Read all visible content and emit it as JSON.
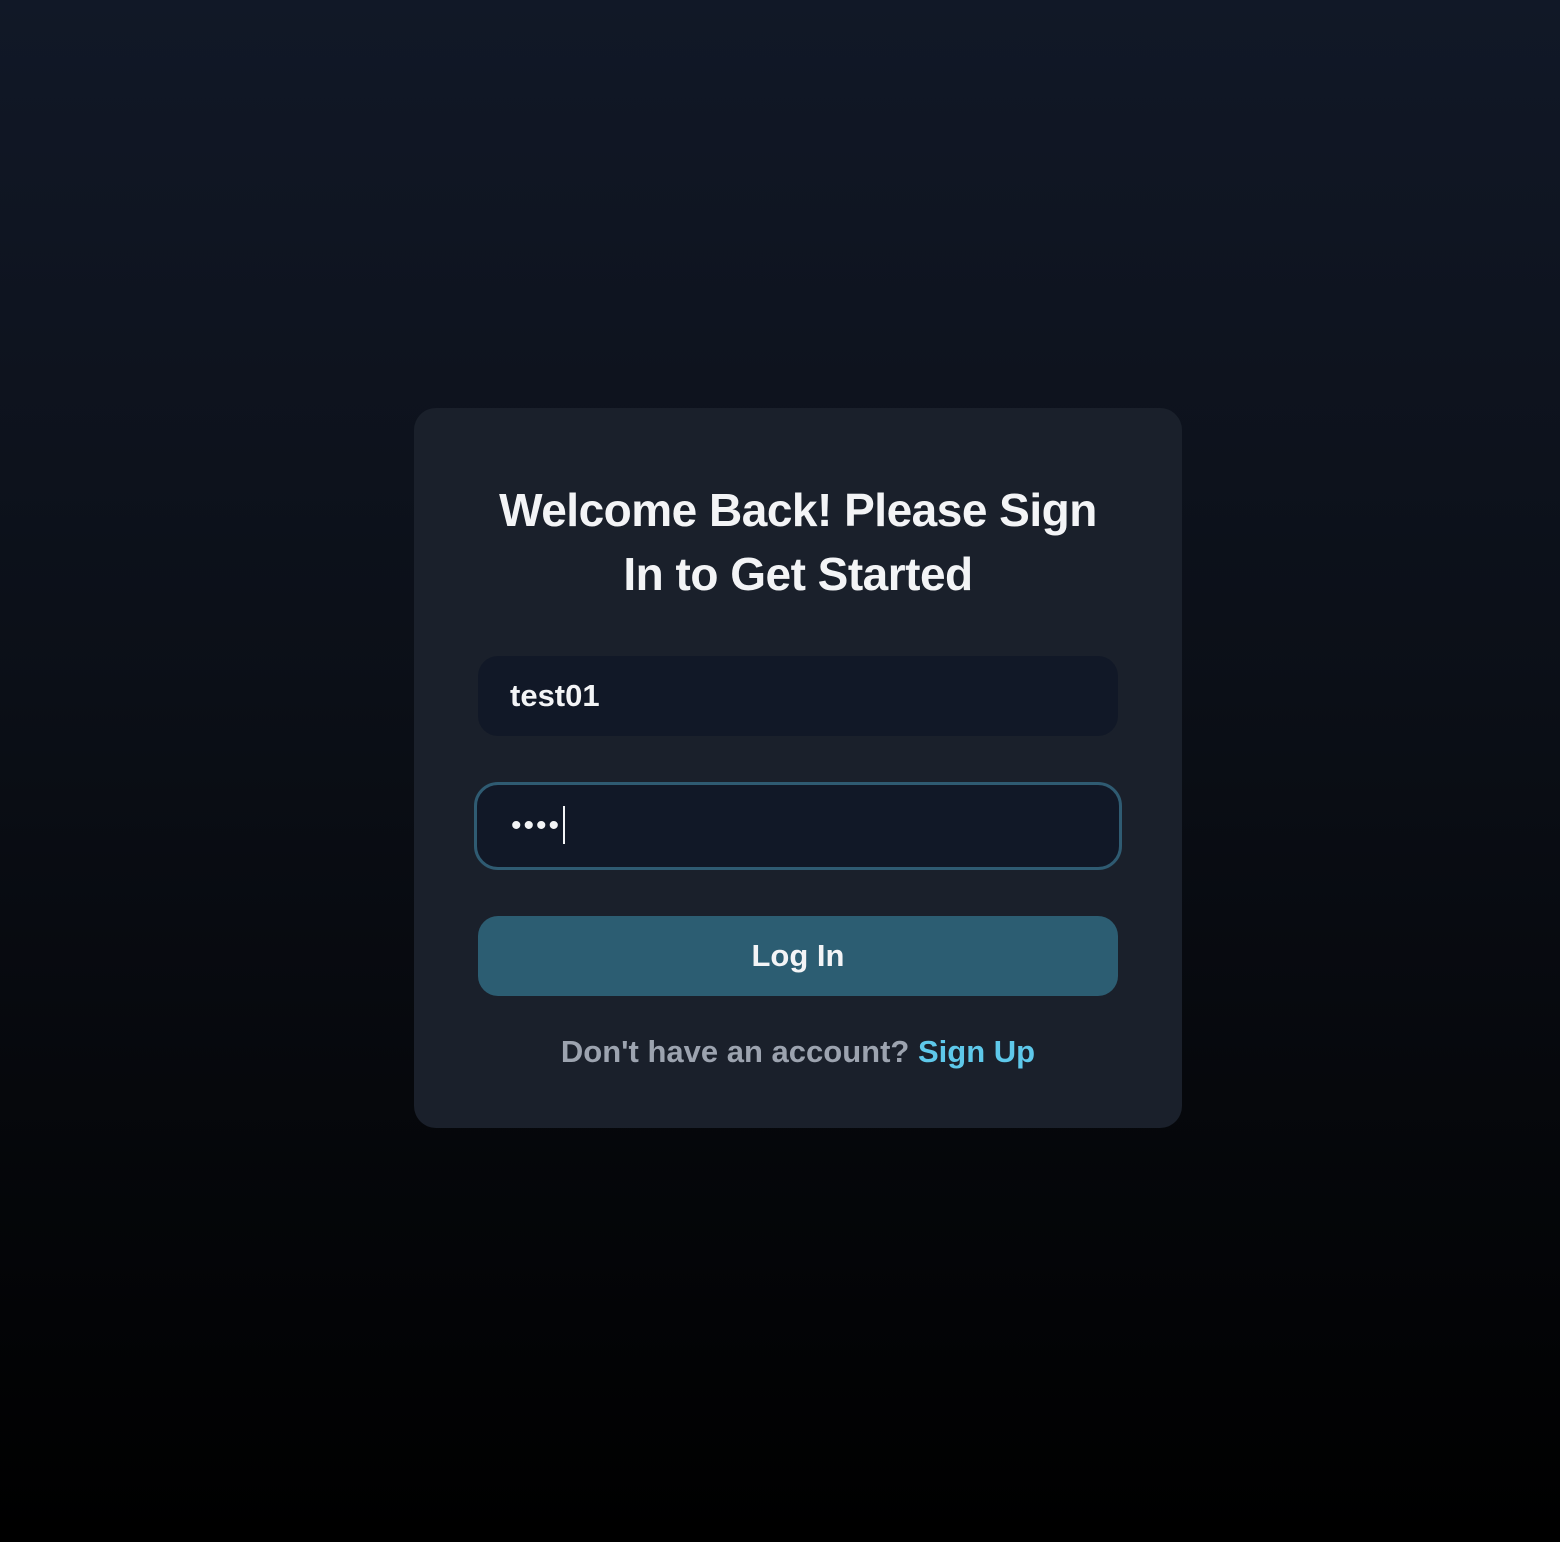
{
  "login": {
    "title": "Welcome Back! Please Sign In to Get Started",
    "username_value": "test01",
    "password_mask": "••••",
    "login_label": "Log In",
    "signup_prompt": "Don't have an account?",
    "signup_label": "Sign Up"
  },
  "colors": {
    "accent_button": "#2c5d72",
    "link": "#5ec8ea",
    "card": "#1a202b",
    "input": "#111827"
  }
}
